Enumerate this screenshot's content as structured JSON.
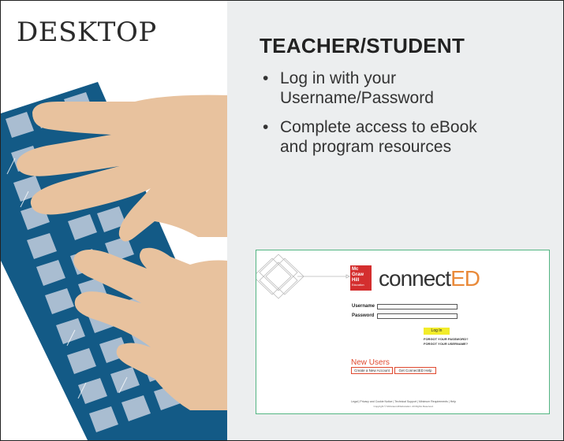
{
  "left": {
    "title": "DESKTOP"
  },
  "right": {
    "heading": "TEACHER/STUDENT",
    "bullets": [
      {
        "line1": "Log in with your",
        "line2": "Username/Password"
      },
      {
        "line1": "Complete access to eBook",
        "line2": "and program resources"
      }
    ]
  },
  "login_screenshot": {
    "logo_text": [
      "Mc",
      "Graw",
      "Hill",
      "Education"
    ],
    "brand_part1": "connect",
    "brand_part2": "ED",
    "username_label": "Username",
    "password_label": "Password",
    "login_button": "Log In",
    "forgot_password": "FORGOT YOUR PASSWORD?",
    "forgot_username": "FORGOT YOUR USERNAME?",
    "new_users_title": "New Users",
    "create_account": "Create a New Account",
    "get_help": "Get ConnectED Help",
    "footer_links": "Legal  |  Privacy and Cookie Notice  |  Technical Support  |  Minimum Requirements  |  Help",
    "copyright": "Copyright © McGraw-Hill Education. All Rights Reserved."
  },
  "colors": {
    "keyboard": "#135a86",
    "key": "#a9bdd1",
    "skin": "#e8c29e",
    "panel_bg": "#eceeef",
    "accent_green": "#53b583",
    "brand_red": "#d42e2e",
    "brand_orange": "#e98a3a",
    "login_yellow": "#f2ec2a"
  },
  "icons": [
    "keyboard-illustration",
    "hands-illustration",
    "diamond-lattice-decoration"
  ]
}
